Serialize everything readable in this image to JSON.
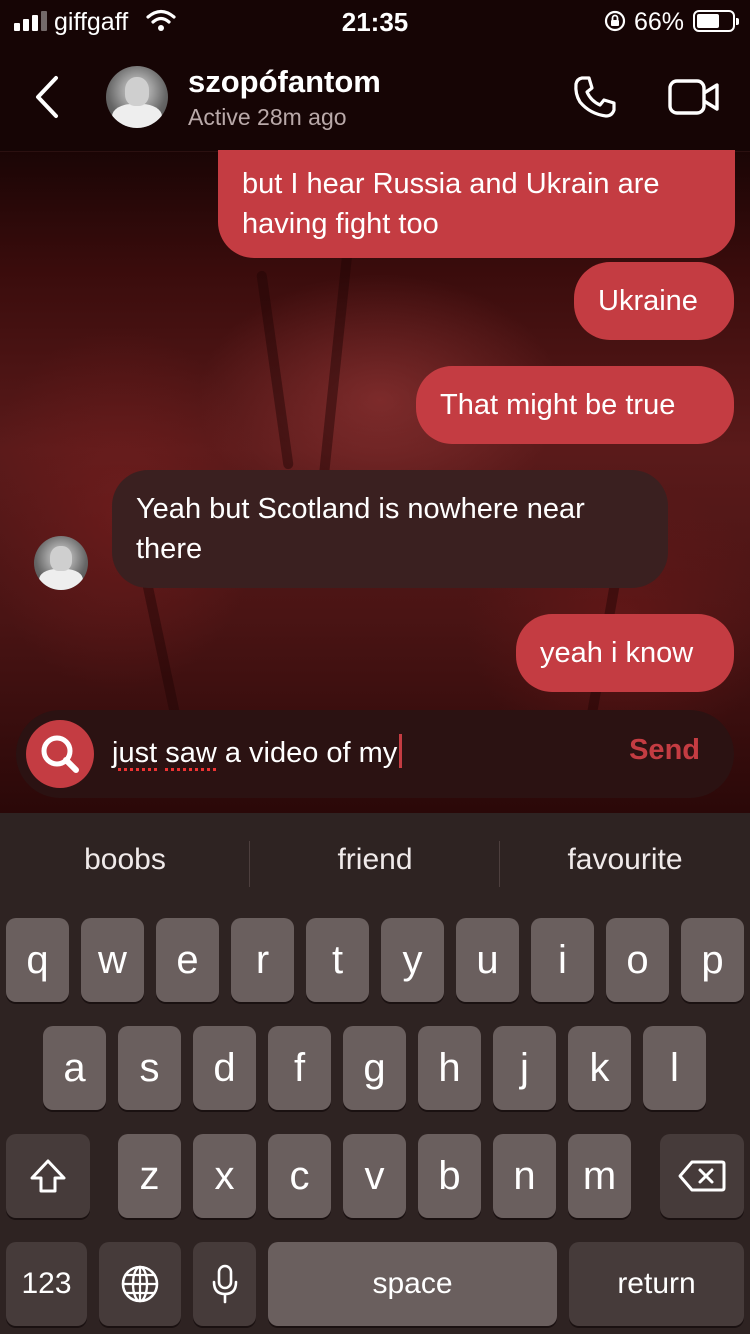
{
  "status": {
    "carrier": "giffgaff",
    "time": "21:35",
    "battery": "66%",
    "battery_level": 0.66
  },
  "header": {
    "contact_name": "szopófantom",
    "contact_status": "Active 28m ago"
  },
  "messages": [
    {
      "from": "me",
      "text_lines": [
        "but I hear Russia and Ukrain are",
        "having fight too"
      ]
    },
    {
      "from": "me",
      "text_lines": [
        "Ukraine"
      ]
    },
    {
      "from": "me",
      "text_lines": [
        "That might be true"
      ]
    },
    {
      "from": "them",
      "text_lines": [
        "Yeah but Scotland is nowhere near",
        "there"
      ]
    },
    {
      "from": "me",
      "text_lines": [
        "yeah i know"
      ]
    }
  ],
  "composer": {
    "word1": "just",
    "word2": "saw",
    "rest": " a video of my",
    "send_label": "Send"
  },
  "keyboard": {
    "predictions": [
      "boobs",
      "friend",
      "favourite"
    ],
    "row1": [
      "q",
      "w",
      "e",
      "r",
      "t",
      "y",
      "u",
      "i",
      "o",
      "p"
    ],
    "row2": [
      "a",
      "s",
      "d",
      "f",
      "g",
      "h",
      "j",
      "k",
      "l"
    ],
    "row3": [
      "z",
      "x",
      "c",
      "v",
      "b",
      "n",
      "m"
    ],
    "numbers_label": "123",
    "space_label": "space",
    "return_label": "return"
  },
  "colors": {
    "sent_bubble": "#c43c42",
    "received_bubble": "#3a2020",
    "accent": "#c43c42"
  }
}
